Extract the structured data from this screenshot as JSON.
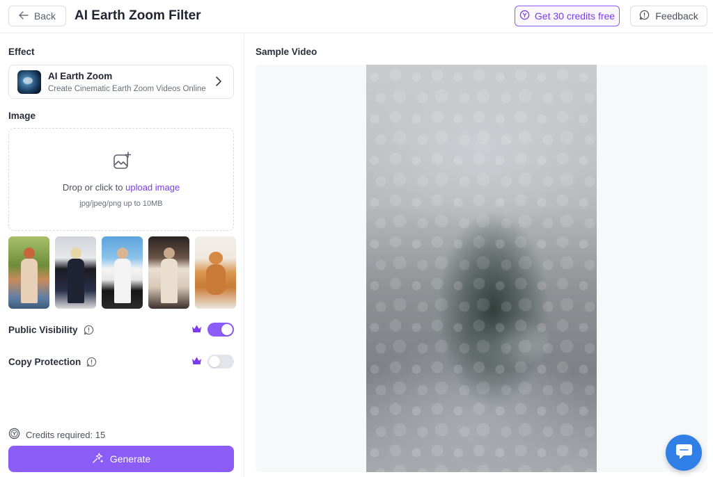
{
  "header": {
    "back_label": "Back",
    "title": "AI Earth Zoom Filter",
    "credits_label": "Get 30 credits free",
    "feedback_label": "Feedback"
  },
  "effect": {
    "section_label": "Effect",
    "name": "AI Earth Zoom",
    "description": "Create Cinematic Earth Zoom Videos Online"
  },
  "image": {
    "section_label": "Image",
    "drop_text": "Drop or click to ",
    "upload_link": "upload image",
    "hint": "jpg/jpeg/png up to 10MB"
  },
  "samples": [
    "sample-woman-red-hair",
    "sample-woman-black-top",
    "sample-man-white-tank",
    "sample-woman-ruffle-dress",
    "sample-corgi"
  ],
  "settings": {
    "public_visibility": {
      "label": "Public Visibility",
      "enabled": true
    },
    "copy_protection": {
      "label": "Copy Protection",
      "enabled": false
    }
  },
  "footer": {
    "credits_required": "Credits required: 15",
    "generate_label": "Generate"
  },
  "preview": {
    "section_label": "Sample Video"
  },
  "colors": {
    "accent": "#8b5cf6",
    "accent_text": "#7c3aed",
    "chat": "#2f7fe6"
  }
}
